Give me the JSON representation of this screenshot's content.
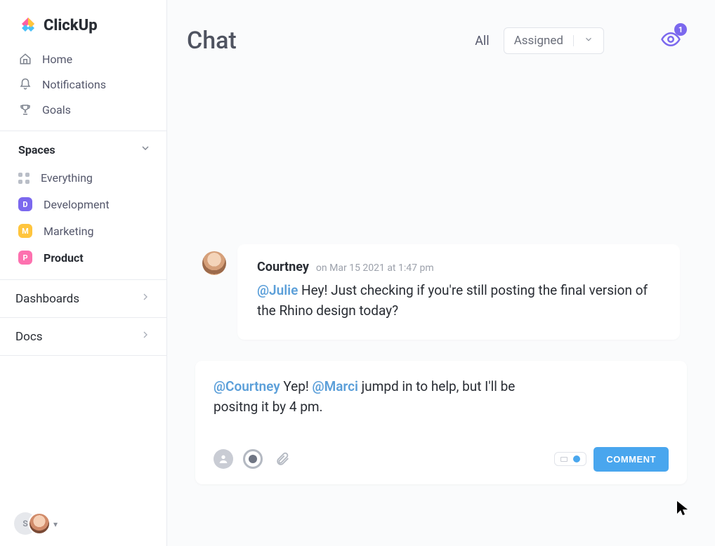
{
  "brand": "ClickUp",
  "nav": {
    "home": "Home",
    "notifications": "Notifications",
    "goals": "Goals"
  },
  "spaces": {
    "header": "Spaces",
    "everything": "Everything",
    "items": [
      {
        "initial": "D",
        "label": "Development",
        "color": "#7b68ee"
      },
      {
        "initial": "M",
        "label": "Marketing",
        "color": "#ffc53d"
      },
      {
        "initial": "P",
        "label": "Product",
        "color": "#fd71af"
      }
    ]
  },
  "sections": {
    "dashboards": "Dashboards",
    "docs": "Docs"
  },
  "user": {
    "initial": "S"
  },
  "chat": {
    "title": "Chat",
    "filter_all": "All",
    "filter_assigned": "Assigned",
    "watchers": "1"
  },
  "messages": [
    {
      "author": "Courtney",
      "time_prefix": "on",
      "time": "Mar 15 2021 at 1:47 pm",
      "mention": "@Julie",
      "body_after": " Hey! Just checking if you're still posting the final version of the Rhino design today?"
    }
  ],
  "composer": {
    "mention1": "@Courtney",
    "text1": " Yep! ",
    "mention2": "@Marci",
    "text2": " jumpd in to help, but I'll be positng it by 4 pm.",
    "button": "COMMENT"
  }
}
